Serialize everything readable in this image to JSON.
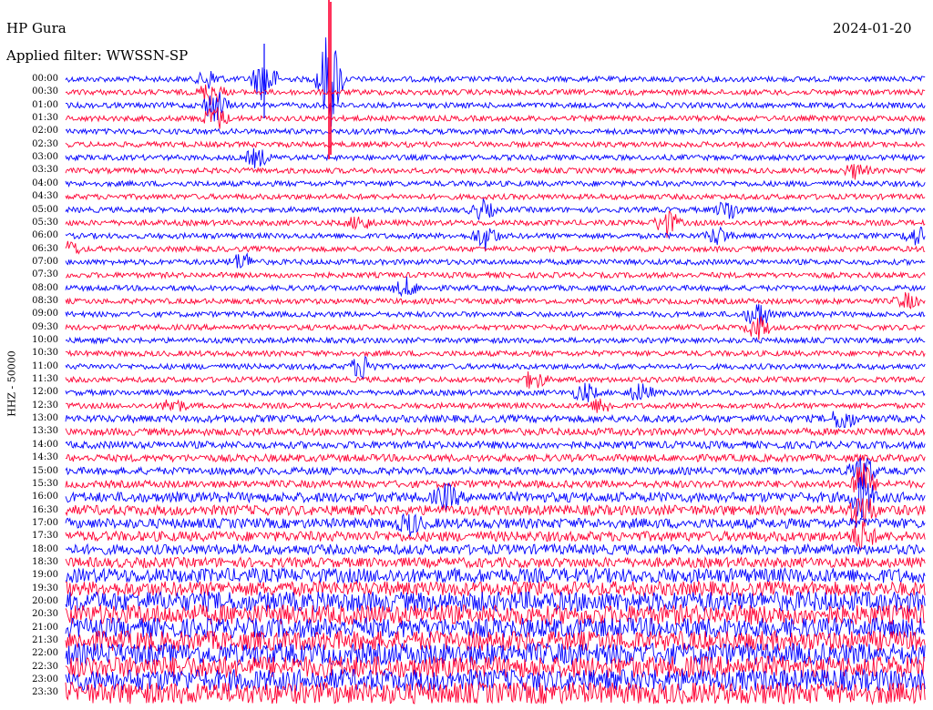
{
  "header": {
    "station": "HP Gura",
    "date": "2024-01-20",
    "filter": "Applied filter: WWSSN-SP"
  },
  "axis": {
    "channel_label": "HHZ - 50000"
  },
  "time_labels": [
    "00:00",
    "00:30",
    "01:00",
    "01:30",
    "02:00",
    "02:30",
    "03:00",
    "03:30",
    "04:00",
    "04:30",
    "05:00",
    "05:30",
    "06:00",
    "06:30",
    "07:00",
    "07:30",
    "08:00",
    "08:30",
    "09:00",
    "09:30",
    "10:00",
    "10:30",
    "11:00",
    "11:30",
    "12:00",
    "12:30",
    "13:00",
    "13:30",
    "14:00",
    "14:30",
    "15:00",
    "15:30",
    "16:00",
    "16:30",
    "17:00",
    "17:30",
    "18:00",
    "18:30",
    "19:00",
    "19:30",
    "20:00",
    "20:30",
    "21:00",
    "21:30",
    "22:00",
    "22:30",
    "23:00",
    "23:30"
  ],
  "colors": {
    "even_trace": "#0000ff",
    "odd_trace": "#ff0033",
    "background": "#ffffff",
    "text": "#000000"
  }
}
